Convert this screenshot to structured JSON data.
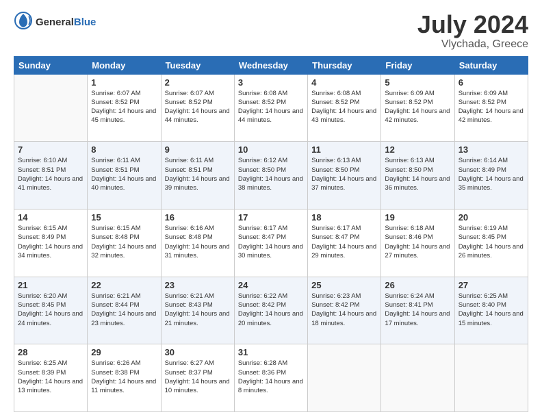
{
  "logo": {
    "text_general": "General",
    "text_blue": "Blue"
  },
  "title": {
    "month_year": "July 2024",
    "location": "Vlychada, Greece"
  },
  "headers": [
    "Sunday",
    "Monday",
    "Tuesday",
    "Wednesday",
    "Thursday",
    "Friday",
    "Saturday"
  ],
  "weeks": [
    [
      {
        "day": "",
        "sunrise": "",
        "sunset": "",
        "daylight": ""
      },
      {
        "day": "1",
        "sunrise": "Sunrise: 6:07 AM",
        "sunset": "Sunset: 8:52 PM",
        "daylight": "Daylight: 14 hours and 45 minutes."
      },
      {
        "day": "2",
        "sunrise": "Sunrise: 6:07 AM",
        "sunset": "Sunset: 8:52 PM",
        "daylight": "Daylight: 14 hours and 44 minutes."
      },
      {
        "day": "3",
        "sunrise": "Sunrise: 6:08 AM",
        "sunset": "Sunset: 8:52 PM",
        "daylight": "Daylight: 14 hours and 44 minutes."
      },
      {
        "day": "4",
        "sunrise": "Sunrise: 6:08 AM",
        "sunset": "Sunset: 8:52 PM",
        "daylight": "Daylight: 14 hours and 43 minutes."
      },
      {
        "day": "5",
        "sunrise": "Sunrise: 6:09 AM",
        "sunset": "Sunset: 8:52 PM",
        "daylight": "Daylight: 14 hours and 42 minutes."
      },
      {
        "day": "6",
        "sunrise": "Sunrise: 6:09 AM",
        "sunset": "Sunset: 8:52 PM",
        "daylight": "Daylight: 14 hours and 42 minutes."
      }
    ],
    [
      {
        "day": "7",
        "sunrise": "Sunrise: 6:10 AM",
        "sunset": "Sunset: 8:51 PM",
        "daylight": "Daylight: 14 hours and 41 minutes."
      },
      {
        "day": "8",
        "sunrise": "Sunrise: 6:11 AM",
        "sunset": "Sunset: 8:51 PM",
        "daylight": "Daylight: 14 hours and 40 minutes."
      },
      {
        "day": "9",
        "sunrise": "Sunrise: 6:11 AM",
        "sunset": "Sunset: 8:51 PM",
        "daylight": "Daylight: 14 hours and 39 minutes."
      },
      {
        "day": "10",
        "sunrise": "Sunrise: 6:12 AM",
        "sunset": "Sunset: 8:50 PM",
        "daylight": "Daylight: 14 hours and 38 minutes."
      },
      {
        "day": "11",
        "sunrise": "Sunrise: 6:13 AM",
        "sunset": "Sunset: 8:50 PM",
        "daylight": "Daylight: 14 hours and 37 minutes."
      },
      {
        "day": "12",
        "sunrise": "Sunrise: 6:13 AM",
        "sunset": "Sunset: 8:50 PM",
        "daylight": "Daylight: 14 hours and 36 minutes."
      },
      {
        "day": "13",
        "sunrise": "Sunrise: 6:14 AM",
        "sunset": "Sunset: 8:49 PM",
        "daylight": "Daylight: 14 hours and 35 minutes."
      }
    ],
    [
      {
        "day": "14",
        "sunrise": "Sunrise: 6:15 AM",
        "sunset": "Sunset: 8:49 PM",
        "daylight": "Daylight: 14 hours and 34 minutes."
      },
      {
        "day": "15",
        "sunrise": "Sunrise: 6:15 AM",
        "sunset": "Sunset: 8:48 PM",
        "daylight": "Daylight: 14 hours and 32 minutes."
      },
      {
        "day": "16",
        "sunrise": "Sunrise: 6:16 AM",
        "sunset": "Sunset: 8:48 PM",
        "daylight": "Daylight: 14 hours and 31 minutes."
      },
      {
        "day": "17",
        "sunrise": "Sunrise: 6:17 AM",
        "sunset": "Sunset: 8:47 PM",
        "daylight": "Daylight: 14 hours and 30 minutes."
      },
      {
        "day": "18",
        "sunrise": "Sunrise: 6:17 AM",
        "sunset": "Sunset: 8:47 PM",
        "daylight": "Daylight: 14 hours and 29 minutes."
      },
      {
        "day": "19",
        "sunrise": "Sunrise: 6:18 AM",
        "sunset": "Sunset: 8:46 PM",
        "daylight": "Daylight: 14 hours and 27 minutes."
      },
      {
        "day": "20",
        "sunrise": "Sunrise: 6:19 AM",
        "sunset": "Sunset: 8:45 PM",
        "daylight": "Daylight: 14 hours and 26 minutes."
      }
    ],
    [
      {
        "day": "21",
        "sunrise": "Sunrise: 6:20 AM",
        "sunset": "Sunset: 8:45 PM",
        "daylight": "Daylight: 14 hours and 24 minutes."
      },
      {
        "day": "22",
        "sunrise": "Sunrise: 6:21 AM",
        "sunset": "Sunset: 8:44 PM",
        "daylight": "Daylight: 14 hours and 23 minutes."
      },
      {
        "day": "23",
        "sunrise": "Sunrise: 6:21 AM",
        "sunset": "Sunset: 8:43 PM",
        "daylight": "Daylight: 14 hours and 21 minutes."
      },
      {
        "day": "24",
        "sunrise": "Sunrise: 6:22 AM",
        "sunset": "Sunset: 8:42 PM",
        "daylight": "Daylight: 14 hours and 20 minutes."
      },
      {
        "day": "25",
        "sunrise": "Sunrise: 6:23 AM",
        "sunset": "Sunset: 8:42 PM",
        "daylight": "Daylight: 14 hours and 18 minutes."
      },
      {
        "day": "26",
        "sunrise": "Sunrise: 6:24 AM",
        "sunset": "Sunset: 8:41 PM",
        "daylight": "Daylight: 14 hours and 17 minutes."
      },
      {
        "day": "27",
        "sunrise": "Sunrise: 6:25 AM",
        "sunset": "Sunset: 8:40 PM",
        "daylight": "Daylight: 14 hours and 15 minutes."
      }
    ],
    [
      {
        "day": "28",
        "sunrise": "Sunrise: 6:25 AM",
        "sunset": "Sunset: 8:39 PM",
        "daylight": "Daylight: 14 hours and 13 minutes."
      },
      {
        "day": "29",
        "sunrise": "Sunrise: 6:26 AM",
        "sunset": "Sunset: 8:38 PM",
        "daylight": "Daylight: 14 hours and 11 minutes."
      },
      {
        "day": "30",
        "sunrise": "Sunrise: 6:27 AM",
        "sunset": "Sunset: 8:37 PM",
        "daylight": "Daylight: 14 hours and 10 minutes."
      },
      {
        "day": "31",
        "sunrise": "Sunrise: 6:28 AM",
        "sunset": "Sunset: 8:36 PM",
        "daylight": "Daylight: 14 hours and 8 minutes."
      },
      {
        "day": "",
        "sunrise": "",
        "sunset": "",
        "daylight": ""
      },
      {
        "day": "",
        "sunrise": "",
        "sunset": "",
        "daylight": ""
      },
      {
        "day": "",
        "sunrise": "",
        "sunset": "",
        "daylight": ""
      }
    ]
  ]
}
